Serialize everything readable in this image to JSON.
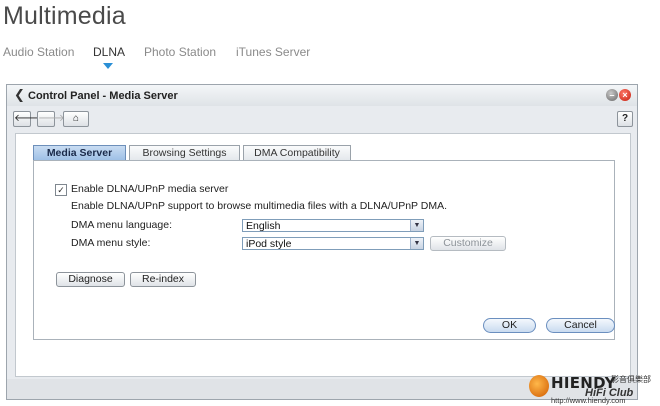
{
  "page": {
    "title": "Multimedia",
    "nav": [
      {
        "label": "Audio Station",
        "active": false
      },
      {
        "label": "DLNA",
        "active": true
      },
      {
        "label": "Photo Station",
        "active": false
      },
      {
        "label": "iTunes Server",
        "active": false
      }
    ]
  },
  "window": {
    "title": "Control Panel - Media Server",
    "toolbar": {
      "help_label": "?"
    },
    "tabs": [
      {
        "label": "Media Server",
        "active": true
      },
      {
        "label": "Browsing Settings",
        "active": false
      },
      {
        "label": "DMA Compatibility",
        "active": false
      }
    ],
    "form": {
      "enable_label": "Enable DLNA/UPnP media server",
      "enable_checked": true,
      "description": "Enable DLNA/UPnP support to browse multimedia files with a DLNA/UPnP DMA.",
      "language_label": "DMA menu language:",
      "language_value": "English",
      "style_label": "DMA menu style:",
      "style_value": "iPod style",
      "customize_label": "Customize"
    },
    "buttons": {
      "diagnose": "Diagnose",
      "reindex": "Re-index",
      "ok": "OK",
      "cancel": "Cancel"
    }
  },
  "watermark": {
    "name": "HIENDY",
    "name_cn": "影音俱樂部",
    "club": "HiFi Club",
    "url": "http://www.hiendy.com"
  },
  "colors": {
    "accent": "#2a8fd6",
    "tab_active": "#9ec0e6",
    "window_bg": "#e8ebef",
    "close_red": "#c41c0c"
  },
  "icons": {
    "back": "arrow-left-icon",
    "forward": "arrow-right-icon",
    "home": "home-icon",
    "help": "help-icon",
    "minimize": "minimize-icon",
    "close": "close-icon",
    "chevron": "chevron-left-icon",
    "dropdown": "chevron-down-icon"
  }
}
